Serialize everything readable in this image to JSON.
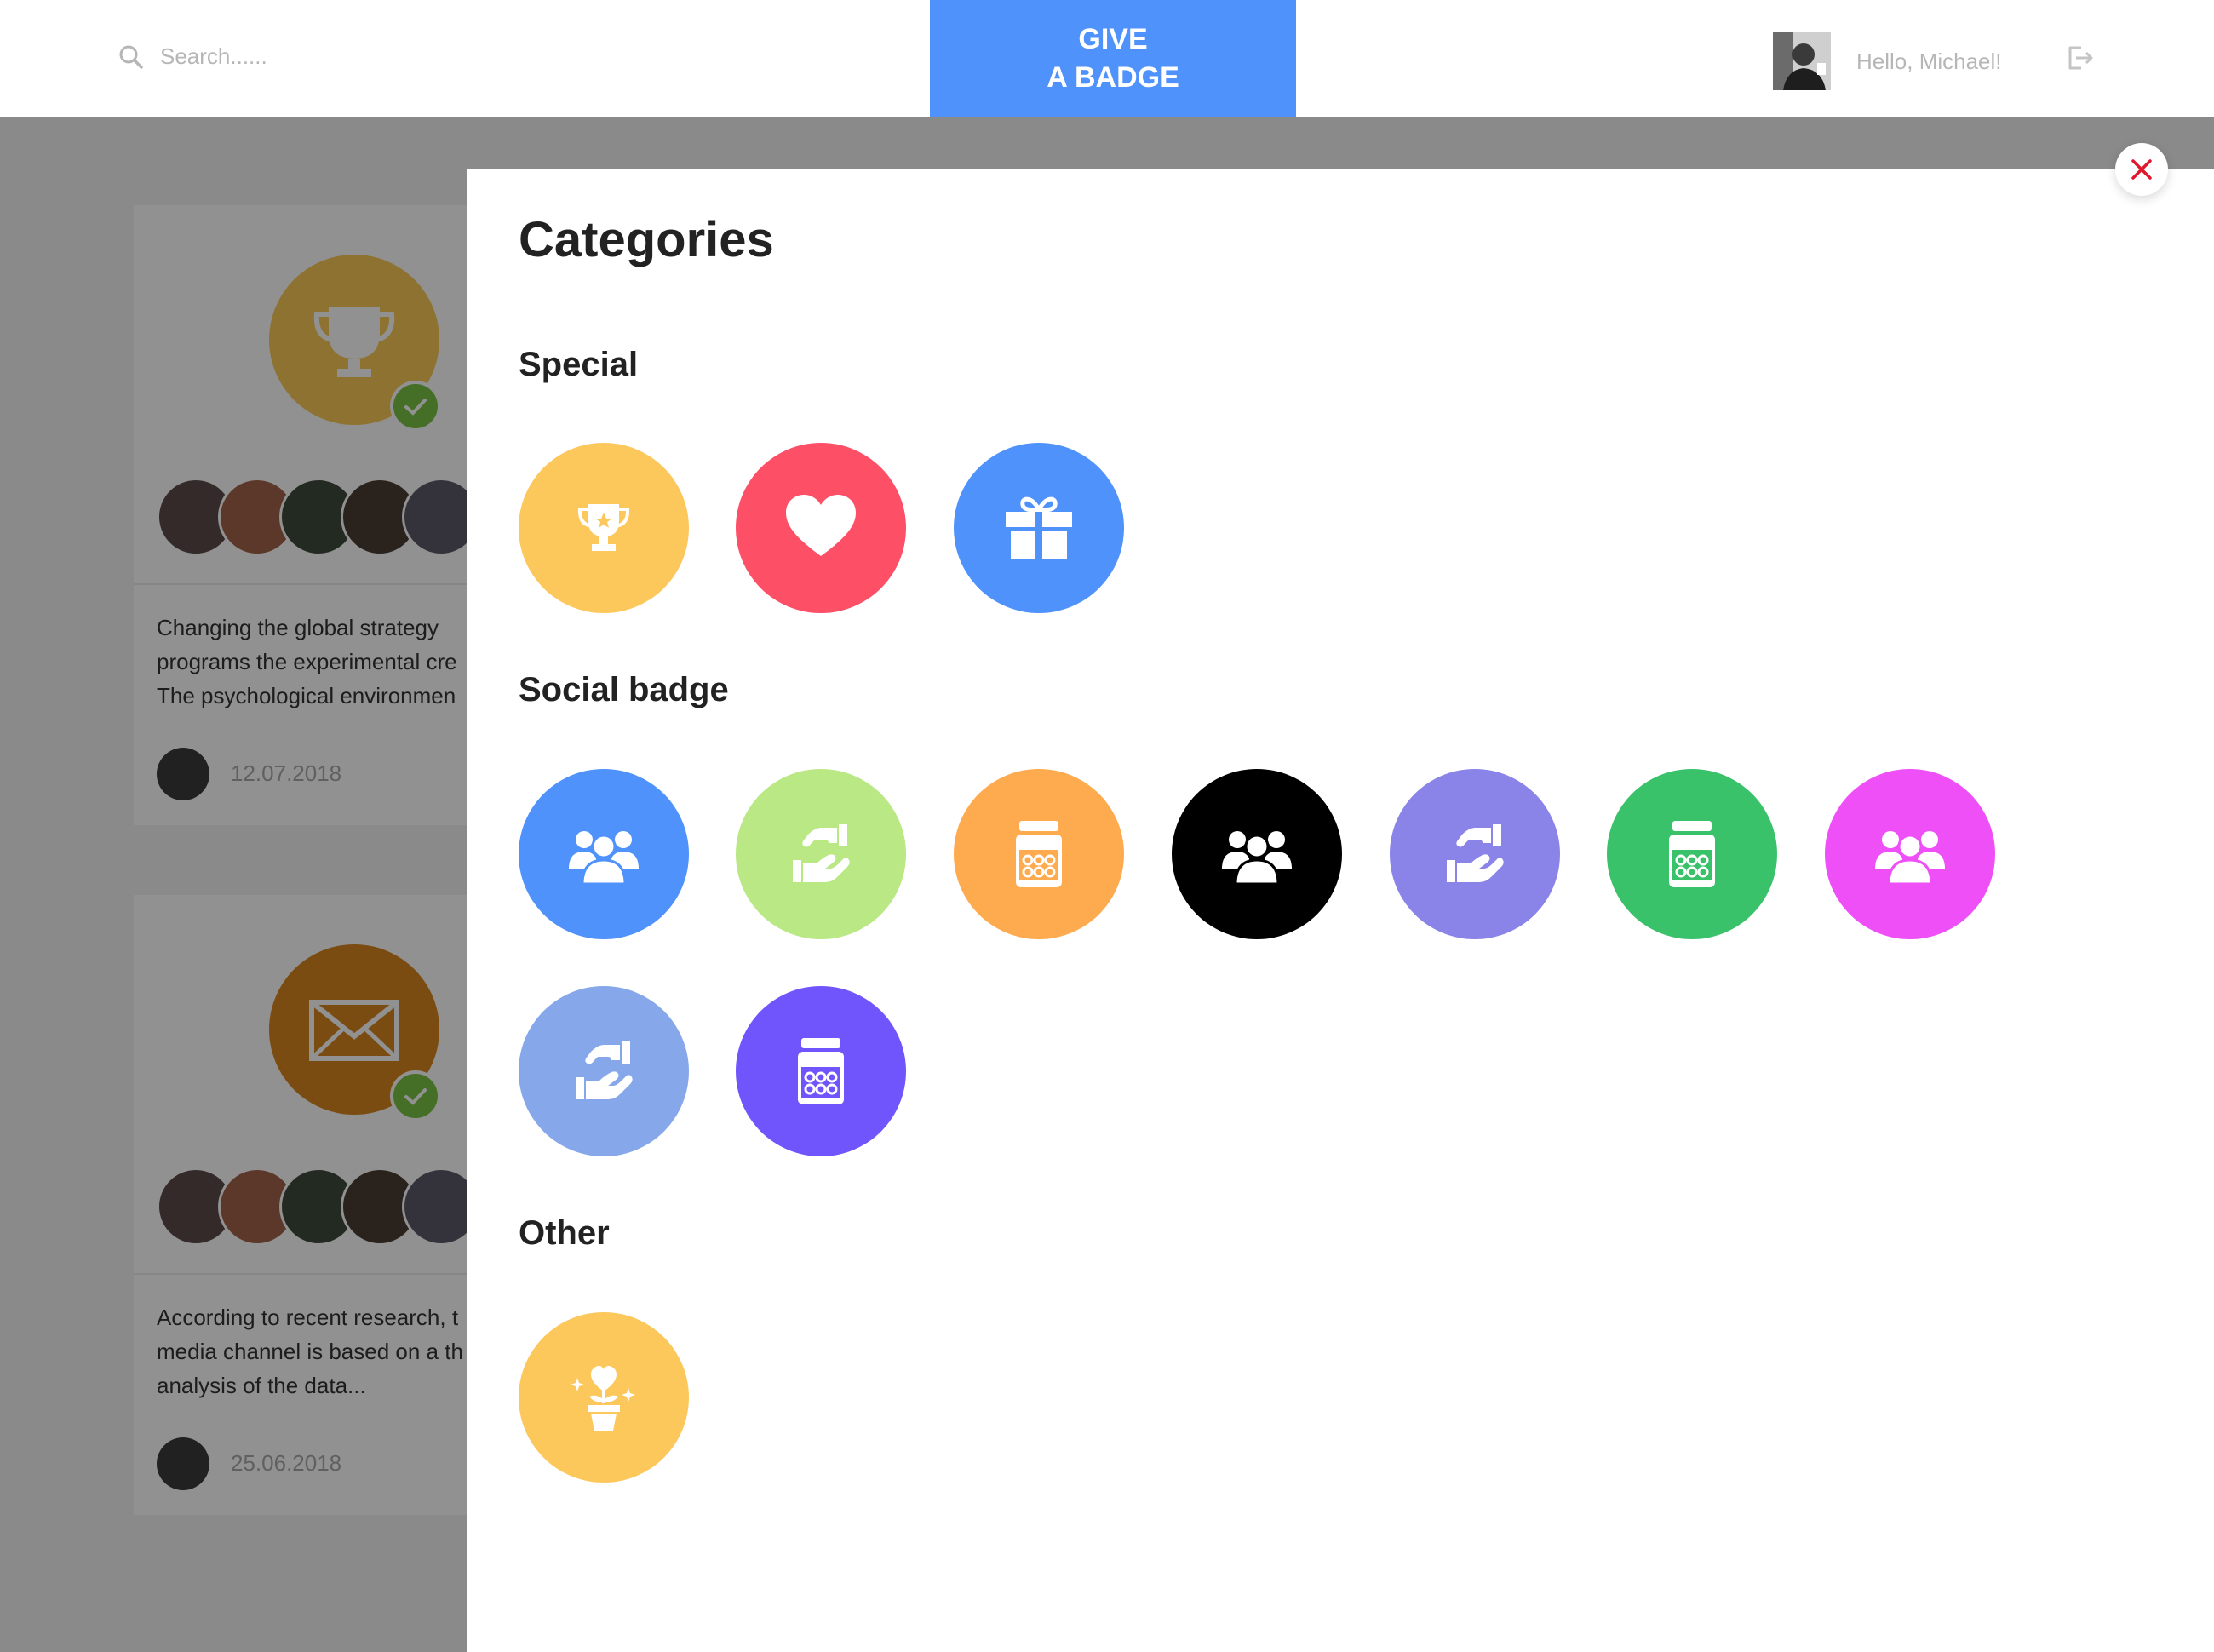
{
  "header": {
    "search_placeholder": "Search......",
    "give_badge_line1": "GIVE",
    "give_badge_line2": "A BADGE",
    "greeting": "Hello, Michael!",
    "accent_color": "#4f92fb"
  },
  "background_cards": [
    {
      "badge_color": "#f8c956",
      "badge_icon": "trophy-icon",
      "text_lines": [
        "Changing the global strategy",
        "programs the experimental cre",
        "The psychological environmen"
      ],
      "date": "12.07.2018"
    },
    {
      "badge_color": "#d9861f",
      "badge_icon": "envelope-icon",
      "text_lines": [
        "According to recent research, t",
        "media channel is based on a th",
        "analysis of the data..."
      ],
      "date": "25.06.2018"
    }
  ],
  "modal": {
    "title": "Categories",
    "sections": [
      {
        "title": "Special",
        "badges": [
          {
            "color": "#fcc85c",
            "icon": "trophy-icon"
          },
          {
            "color": "#fd4f66",
            "icon": "heart-icon"
          },
          {
            "color": "#4f92fb",
            "icon": "gift-icon"
          }
        ]
      },
      {
        "title": "Social badge",
        "badges": [
          {
            "color": "#4f92fb",
            "icon": "people-group-icon"
          },
          {
            "color": "#bae884",
            "icon": "handshake-icon"
          },
          {
            "color": "#feab50",
            "icon": "jar-icon"
          },
          {
            "color": "#000000",
            "icon": "people-group-icon"
          },
          {
            "color": "#8a84e9",
            "icon": "handshake-icon"
          },
          {
            "color": "#3ac26b",
            "icon": "jar-icon"
          },
          {
            "color": "#ee4ff6",
            "icon": "people-group-icon"
          },
          {
            "color": "#86a7ea",
            "icon": "handshake-icon"
          },
          {
            "color": "#6f55fb",
            "icon": "jar-icon"
          }
        ]
      },
      {
        "title": "Other",
        "badges": [
          {
            "color": "#fcc85c",
            "icon": "plant-heart-icon"
          }
        ]
      }
    ]
  },
  "close_color": "#e0182c"
}
